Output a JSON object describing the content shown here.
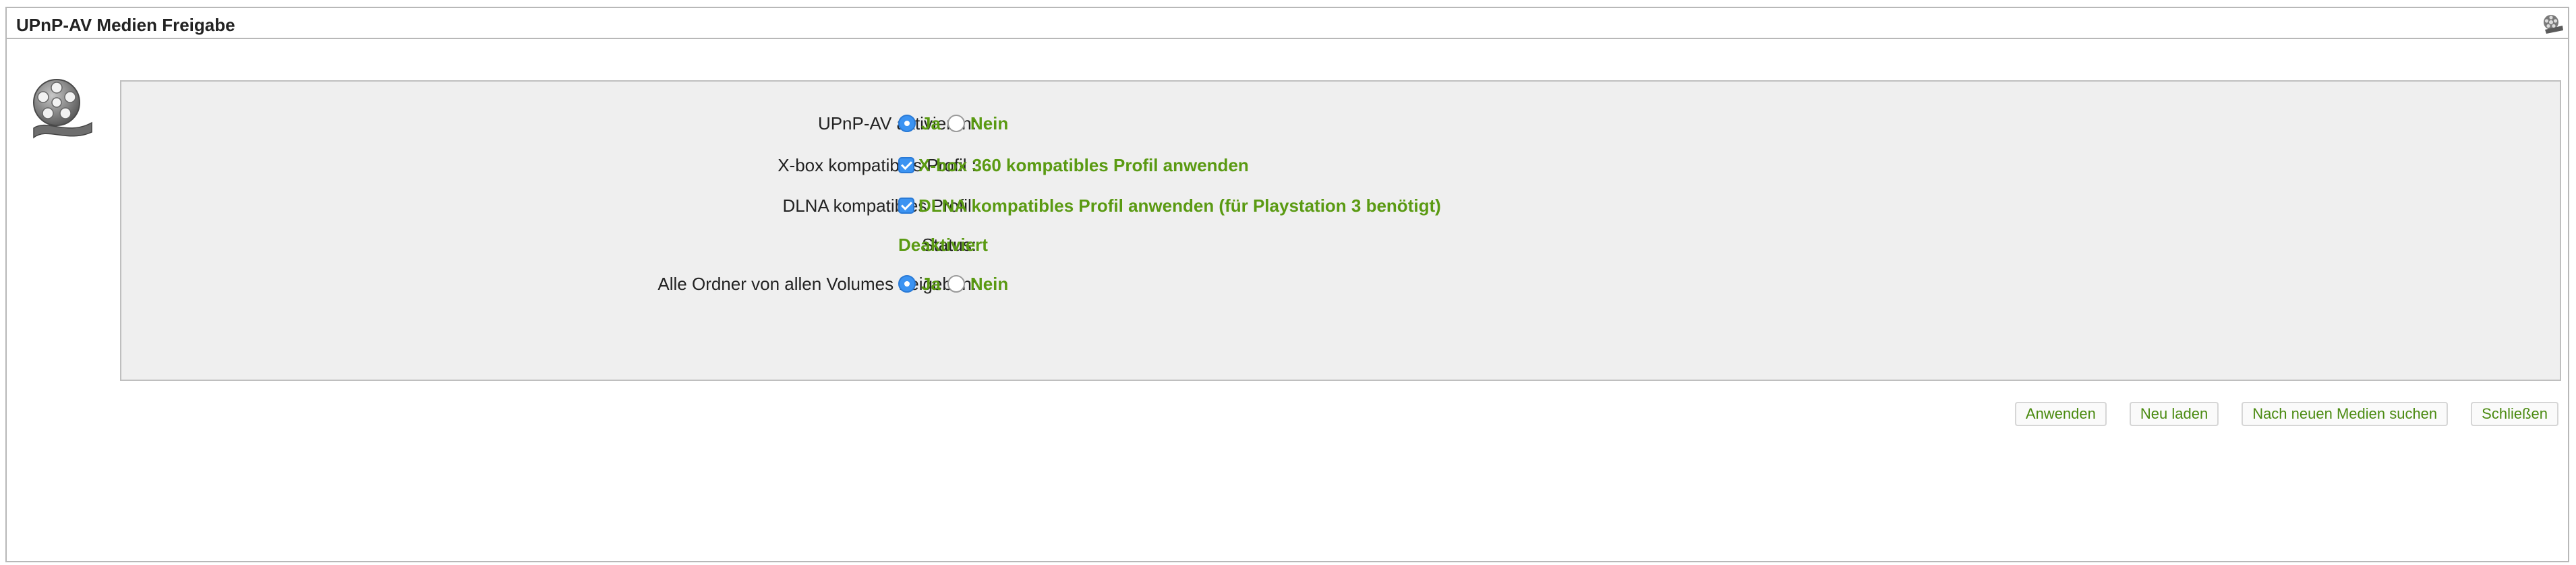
{
  "window": {
    "title": "UPnP-AV Medien Freigabe"
  },
  "icons": {
    "title_icon": "film-reel-icon",
    "app_icon": "film-reel-icon"
  },
  "colors": {
    "accent_green": "#5a9a12",
    "radio_blue": "#3b93f2",
    "panel_bg": "#efefef"
  },
  "form": {
    "upnp": {
      "label": "UPnP-AV aktivieren:",
      "options": [
        "Ja",
        "Nein"
      ],
      "selected": "Ja"
    },
    "xbox": {
      "label": "X-box kompatibles Profil :",
      "checkbox_label": "X-box 360 kompatibles Profil anwenden",
      "checked": true
    },
    "dlna": {
      "label": "DLNA kompatibles Profil:",
      "checkbox_label": "DLNA kompatibles Profil anwenden (für Playstation 3 benötigt)",
      "checked": true
    },
    "status": {
      "label": "Status:",
      "value": "Deaktiviert"
    },
    "all_folders": {
      "label": "Alle Ordner von allen Volumes freigeben:",
      "options": [
        "Ja",
        "Nein"
      ],
      "selected": "Ja"
    }
  },
  "buttons": {
    "apply": "Anwenden",
    "reload": "Neu laden",
    "scan": "Nach neuen Medien suchen",
    "close": "Schließen"
  }
}
